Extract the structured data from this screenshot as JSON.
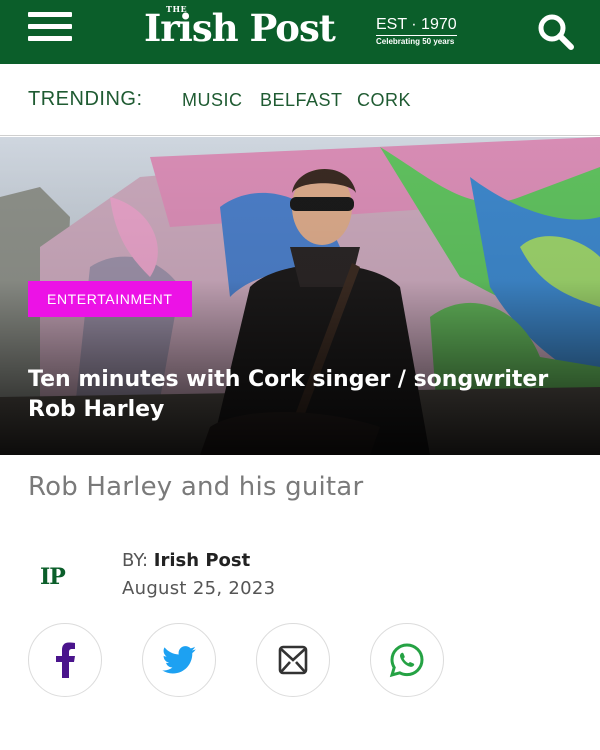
{
  "header": {
    "logo_the": "THE",
    "logo_name": "Irish Post",
    "logo_est": "EST · 1970",
    "logo_tagline": "Celebrating 50 years",
    "menu_icon": "hamburger-menu-icon",
    "search_icon": "search-icon",
    "background_color": "#0b5e2a"
  },
  "trending": {
    "label": "TRENDING:",
    "links": [
      "MUSIC",
      "BELFAST",
      "CORK"
    ],
    "color": "#1f5b32"
  },
  "hero": {
    "category": "ENTERTAINMENT",
    "category_color": "#ec12e6",
    "title": "Ten minutes with Cork singer / songwriter Rob Harley"
  },
  "caption": "Rob Harley and his guitar",
  "byline": {
    "author_logo": "IP",
    "by_label": "BY:",
    "author": "Irish Post",
    "date": "August 25, 2023"
  },
  "share": {
    "buttons": [
      {
        "icon": "facebook-icon",
        "color": "#4a148c"
      },
      {
        "icon": "twitter-icon",
        "color": "#1da1f2"
      },
      {
        "icon": "email-icon",
        "color": "#333333"
      },
      {
        "icon": "whatsapp-icon",
        "color": "#25a244"
      }
    ]
  }
}
